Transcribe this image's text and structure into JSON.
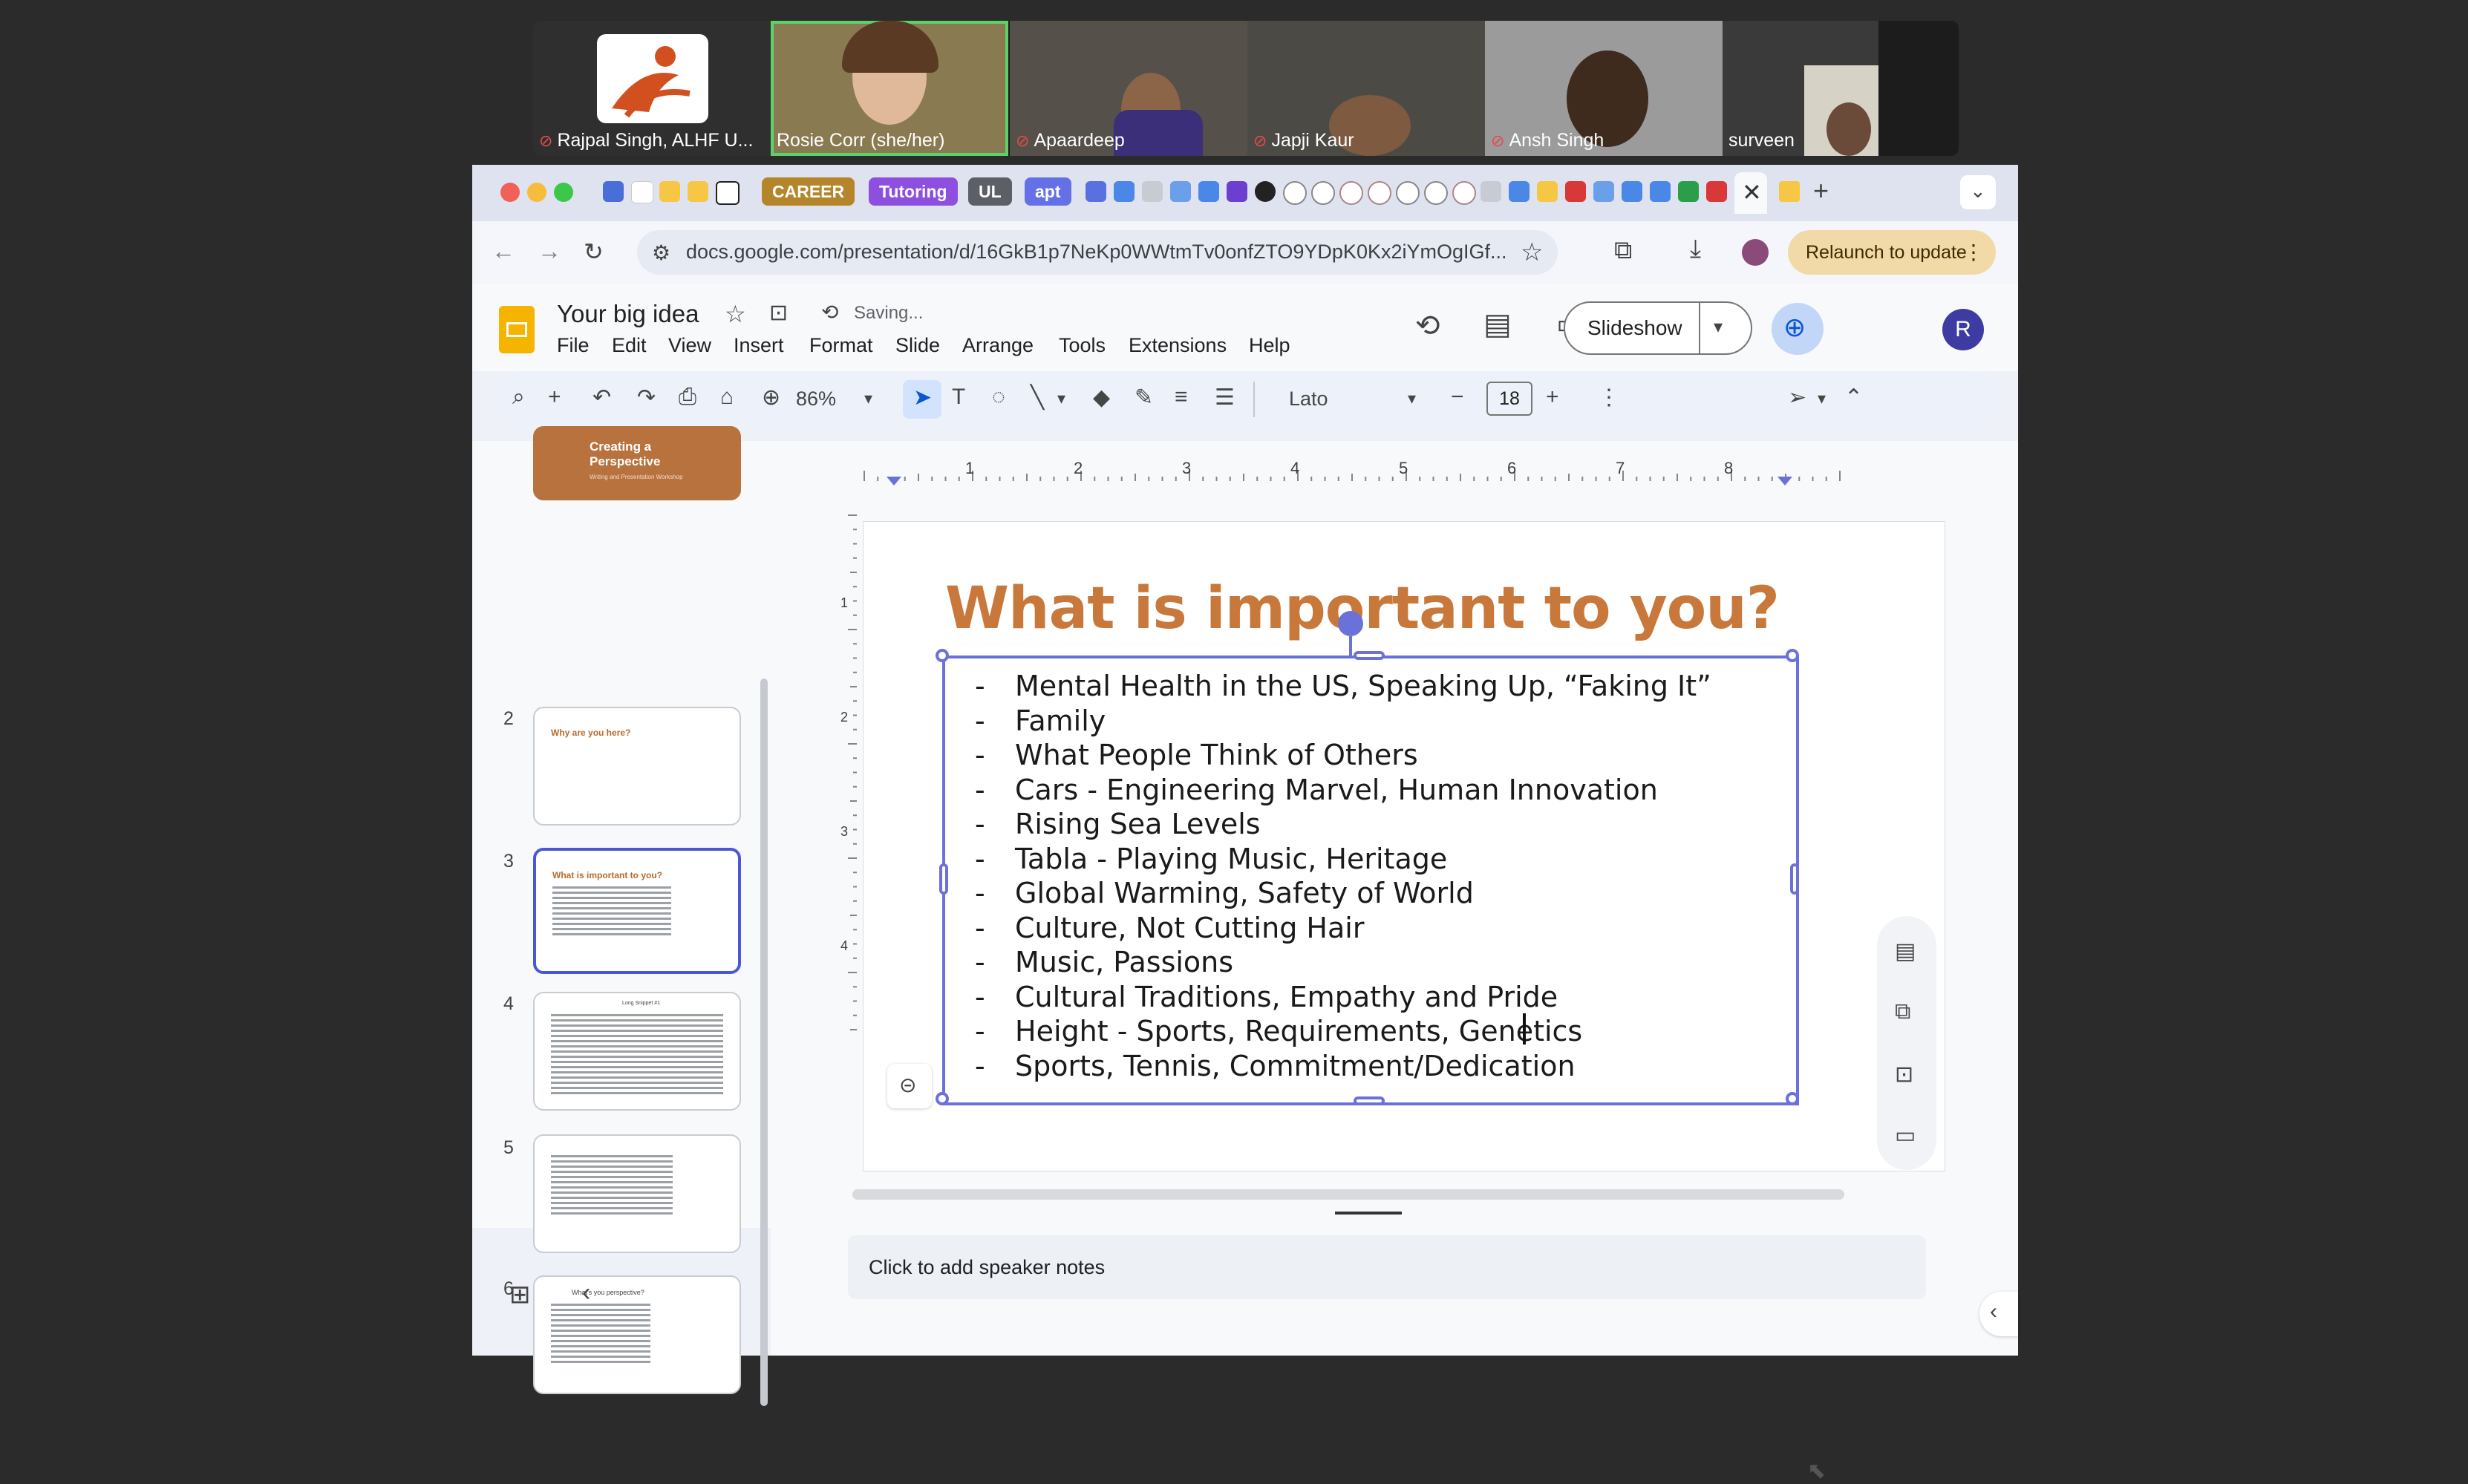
{
  "meeting": {
    "participants": [
      {
        "name": "Rajpal Singh, ALHF U...",
        "muted": true
      },
      {
        "name": "Rosie Corr (she/her)",
        "muted": false
      },
      {
        "name": "Apaardeep",
        "muted": true
      },
      {
        "name": "Japji Kaur",
        "muted": true
      },
      {
        "name": "Ansh Singh",
        "muted": true
      },
      {
        "name": "surveen",
        "muted": false
      }
    ]
  },
  "browser": {
    "tab_groups": [
      "CAREER",
      "Tutoring",
      "UL",
      "apt"
    ],
    "tab_group_colors": [
      "#b5852a",
      "#8e4fe0",
      "#5c5f66",
      "#6471e6"
    ],
    "url": "docs.google.com/presentation/d/16GkB1p7NeKp0WWtmTv0onfZTO9YDpK0Kx2iYmOgIGf...",
    "relaunch_label": "Relaunch to update"
  },
  "doc": {
    "title": "Your big idea",
    "status": "Saving...",
    "menu": [
      "File",
      "Edit",
      "View",
      "Insert",
      "Format",
      "Slide",
      "Arrange",
      "Tools",
      "Extensions",
      "Help"
    ],
    "slideshow_label": "Slideshow",
    "avatar_letter": "R"
  },
  "toolbar": {
    "zoom": "86%",
    "font": "Lato",
    "font_size": "18"
  },
  "ruler": {
    "labels": [
      "1",
      "2",
      "3",
      "4",
      "5",
      "6",
      "7",
      "8"
    ],
    "vlabels": [
      "1",
      "2",
      "3",
      "4"
    ]
  },
  "filmstrip": {
    "slides": [
      {
        "num": "",
        "title": "Creating a Perspective",
        "subtitle": "Writing and Presentation Workshop"
      },
      {
        "num": "2",
        "title": "Why are you here?"
      },
      {
        "num": "3",
        "title": "What is important to you?"
      },
      {
        "num": "4",
        "title": "Long Snippet #1"
      },
      {
        "num": "5",
        "title": ""
      },
      {
        "num": "6",
        "title": "What's you perspective?"
      }
    ]
  },
  "slide": {
    "title": "What is important to you?",
    "bullets": [
      "Mental Health in the US, Speaking Up, “Faking It”",
      "Family",
      "What People Think of Others",
      "Cars - Engineering Marvel, Human Innovation",
      "Rising Sea Levels",
      "Tabla - Playing Music, Heritage",
      "Global Warming, Safety of World",
      "Culture, Not Cutting Hair",
      "Music, Passions",
      "Cultural Traditions, Empathy and Pride",
      "Height - Sports, Requirements, Genetics",
      "Sports, Tennis, Commitment/Dedication"
    ],
    "bullet_marker": "-"
  },
  "notes": {
    "placeholder": "Click to add speaker notes"
  },
  "colors": {
    "accent": "#6a72d8",
    "title": "#c8783a",
    "relaunch": "#f2d9a8"
  }
}
